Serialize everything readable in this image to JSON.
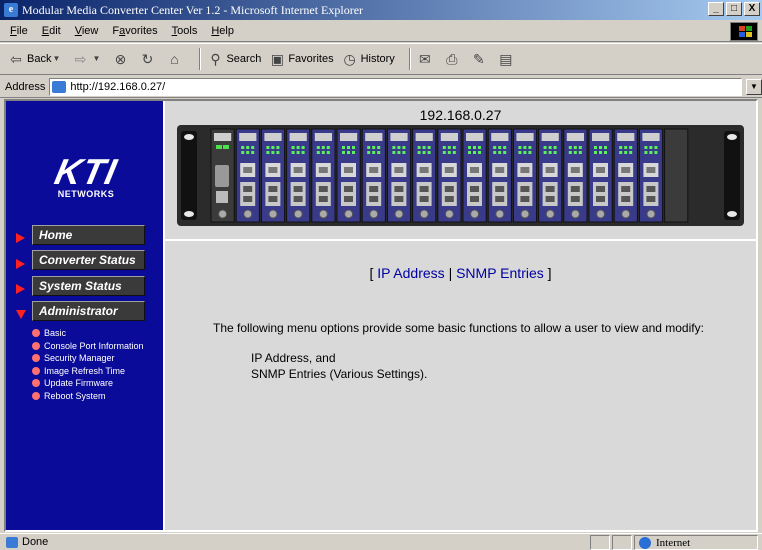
{
  "window": {
    "title": "Modular Media Converter Center Ver 1.2 - Microsoft Internet Explorer",
    "minimize": "_",
    "maximize": "□",
    "close": "X"
  },
  "menubar": {
    "items": [
      {
        "u": "F",
        "rest": "ile"
      },
      {
        "u": "E",
        "rest": "dit"
      },
      {
        "u": "V",
        "rest": "iew"
      },
      {
        "pre": "F",
        "u": "a",
        "rest": "vorites"
      },
      {
        "u": "T",
        "rest": "ools"
      },
      {
        "u": "H",
        "rest": "elp"
      }
    ]
  },
  "toolbar": {
    "back": "Back",
    "search": "Search",
    "favorites": "Favorites",
    "history": "History"
  },
  "address": {
    "label": "Address",
    "url": "http://192.168.0.27/"
  },
  "logo": {
    "main": "KTI",
    "sub": "NETWORKS"
  },
  "nav": {
    "home": "Home",
    "converter_status": "Converter Status",
    "system_status": "System Status",
    "administrator": "Administrator",
    "submenu": [
      "Basic",
      "Console Port Information",
      "Security Manager",
      "Image Refresh Time",
      "Update Firmware",
      "Reboot System"
    ]
  },
  "device": {
    "ip": "192.168.0.27"
  },
  "main": {
    "bracket_open": "[",
    "link_ip": "IP Address",
    "divider": "|",
    "link_snmp": "SNMP Entries",
    "bracket_close": "]",
    "description": "The following menu options provide some basic functions to allow a user to view and modify:",
    "option1": "IP Address, and",
    "option2": "SNMP Entries (Various Settings)."
  },
  "status": {
    "text": "Done",
    "zone": "Internet"
  },
  "colors": {
    "sidebar": "#0b0b9a",
    "nav_button": "#3a3a3a",
    "arrow": "#ff2020",
    "link": "#0000a0",
    "slot_highlight": "#3a3a8a"
  },
  "chassis": {
    "slots_total": 19,
    "slots_populated": 18
  }
}
